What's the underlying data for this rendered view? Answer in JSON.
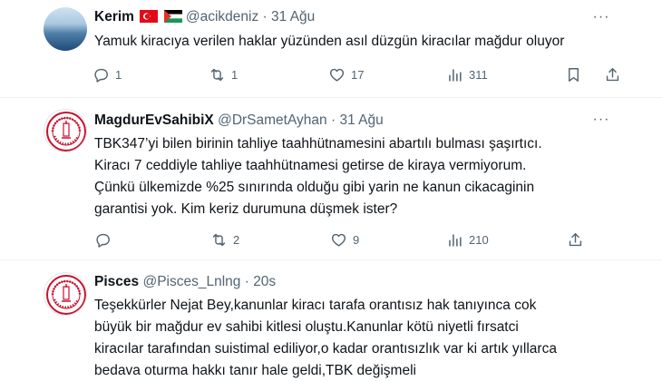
{
  "tweets": [
    {
      "name": "Kerim",
      "handle": "@acikdeniz",
      "sep": "·",
      "time": "31 Ağu",
      "text": "Yamuk kiracıya verilen haklar yüzünden asıl düzgün kiracılar mağdur oluyor",
      "replies": "1",
      "retweets": "1",
      "likes": "17",
      "views": "311"
    },
    {
      "name": "MagdurEvSahibiX",
      "handle": "@DrSametAyhan",
      "sep": "·",
      "time": "31 Ağu",
      "text": "TBK347’yi bilen birinin tahliye taahhütnamesini abartılı bulması şaşırtıcı.\nKiracı 7 ceddiyle tahliye taahhütnamesi getirse de kiraya vermiyorum.\nÇünkü ülkemizde %25 sınırında olduğu gibi yarin ne kanun cikacaginin\ngarantisi yok. Kim keriz durumuna düşmek ister?",
      "replies": "",
      "retweets": "2",
      "likes": "9",
      "views": "210"
    },
    {
      "name": "Pisces",
      "handle": "@Pisces_Lnlng",
      "sep": "·",
      "time": "20s",
      "text": "Teşekkürler Nejat Bey,kanunlar kiracı tarafa orantısız hak tanıyınca cok\nbüyük bir mağdur ev sahibi kitlesi oluştu.Kanunlar kötü niyetli fırsatci\nkiracılar tarafından suistimal ediliyor,o kadar orantısızlık var ki artık yıllarca\nbedava oturma hakkı tanır hale geldi,TBK değişmeli"
    }
  ],
  "icons": {
    "reply": "reply-bubble-icon",
    "retweet": "retweet-arrows-icon",
    "like": "heart-icon",
    "views": "analytics-bars-icon",
    "bookmark": "bookmark-icon",
    "share": "share-upload-icon",
    "more": "more-dots-icon"
  },
  "colors": {
    "text": "#0f1419",
    "muted": "#536471",
    "divider": "#eff3f4",
    "seal_red": "#c8102e"
  }
}
